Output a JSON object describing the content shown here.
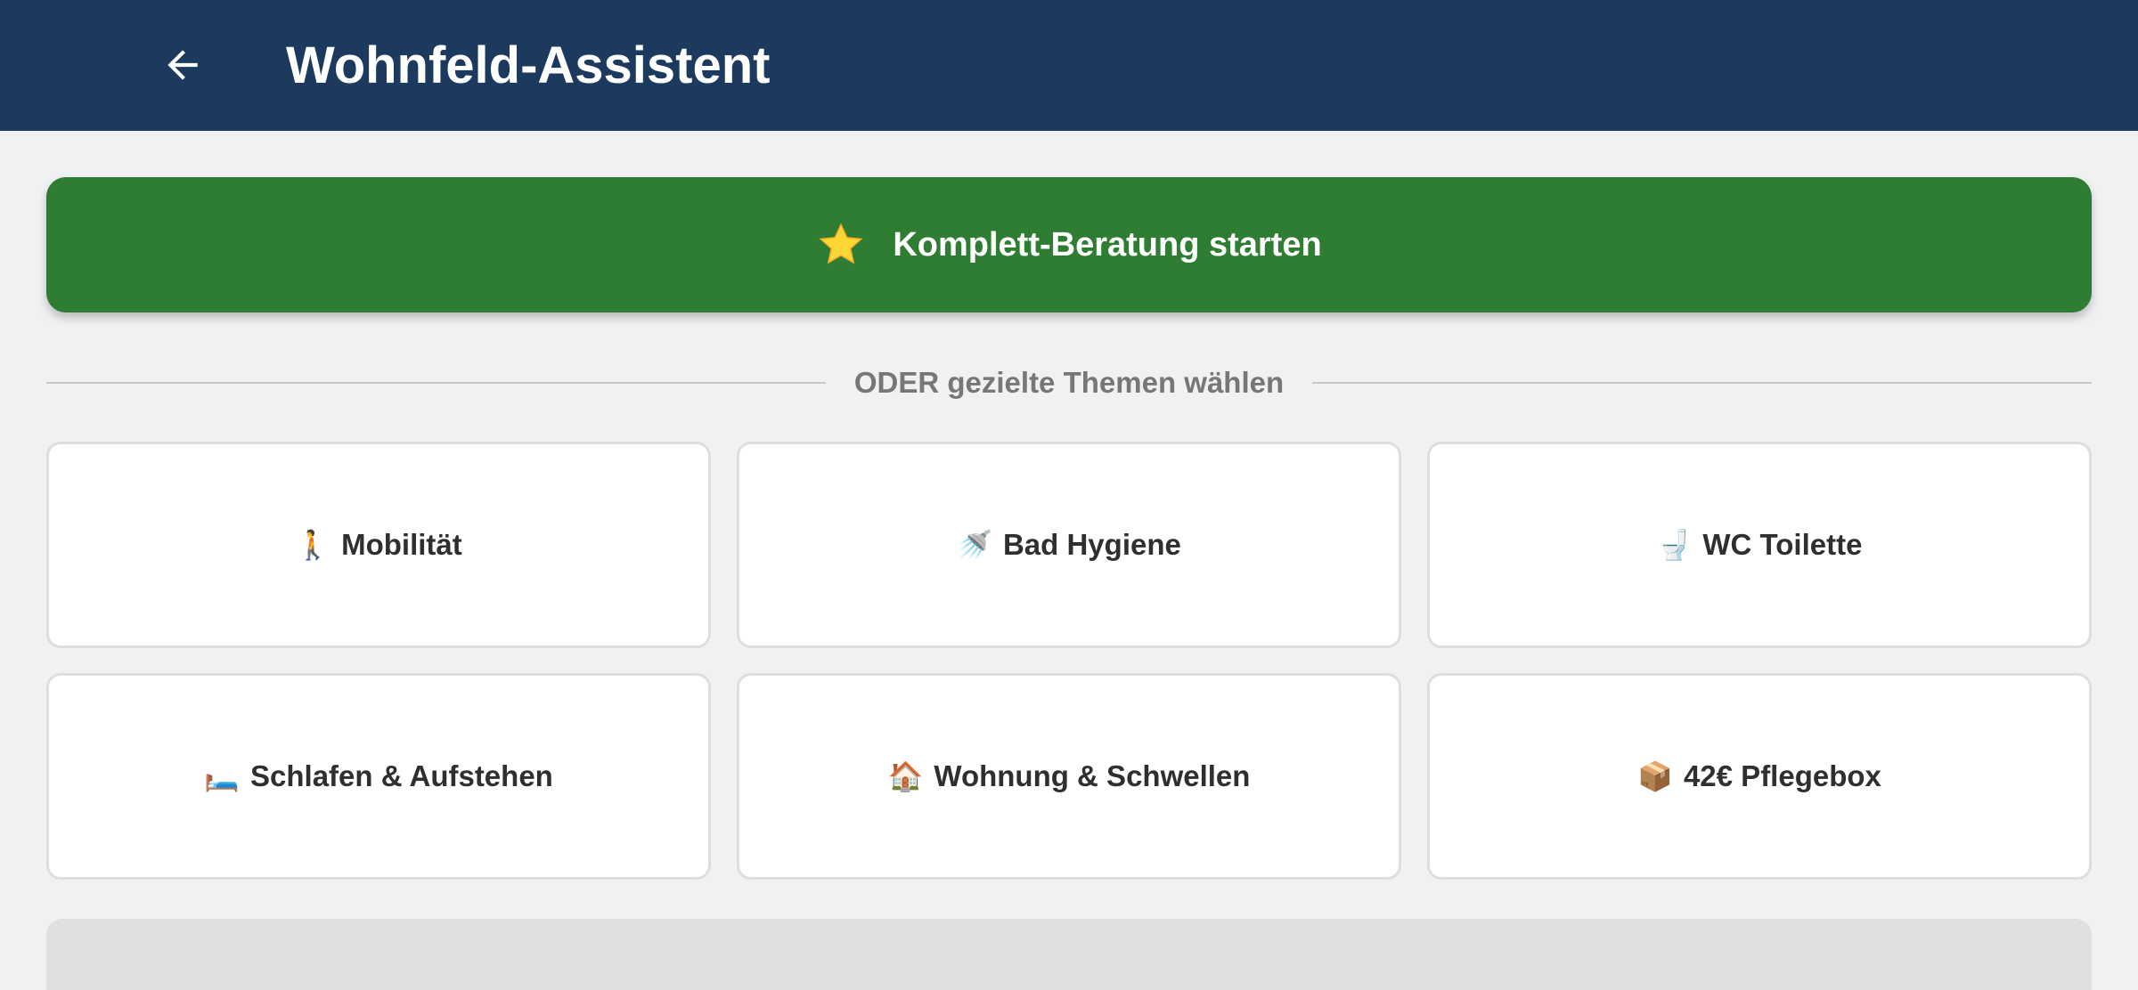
{
  "appbar": {
    "title": "Wohnfeld-Assistent",
    "back_icon": "arrow-left-icon",
    "background_color": "#1b3a5e"
  },
  "primary_action": {
    "label": "Komplett-Beratung starten",
    "icon": "star-icon",
    "color": "#2e7d32"
  },
  "divider": {
    "label": "ODER gezielte Themen wählen"
  },
  "topics": [
    {
      "emoji": "🚶",
      "label": "Mobilität"
    },
    {
      "emoji": "🚿",
      "label": "Bad Hygiene"
    },
    {
      "emoji": "🚽",
      "label": "WC Toilette"
    },
    {
      "emoji": "🛏️",
      "label": "Schlafen & Aufstehen"
    },
    {
      "emoji": "🏠",
      "label": "Wohnung & Schwellen"
    },
    {
      "emoji": "📦",
      "label": "42€ Pflegebox"
    }
  ]
}
